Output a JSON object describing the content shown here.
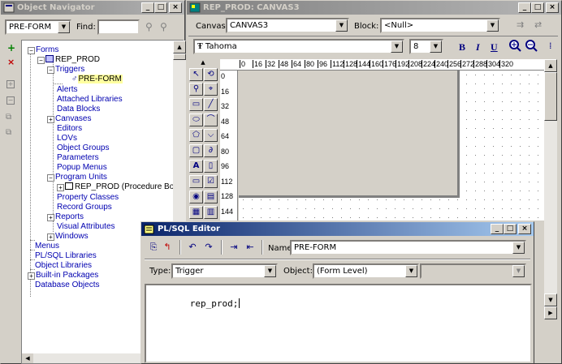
{
  "navigator": {
    "title": "Object Navigator",
    "selector_value": "PRE-FORM",
    "find_label": "Find:",
    "find_value": "",
    "tree": {
      "forms": "Forms",
      "module": "REP_PROD",
      "triggers": "Triggers",
      "trigger_item": "PRE-FORM",
      "alerts": "Alerts",
      "attached_libraries": "Attached Libraries",
      "data_blocks": "Data Blocks",
      "canvases": "Canvases",
      "editors": "Editors",
      "lovs": "LOVs",
      "object_groups": "Object Groups",
      "parameters": "Parameters",
      "popup_menus": "Popup Menus",
      "program_units": "Program Units",
      "program_unit_item": "REP_PROD (Procedure Body",
      "property_classes": "Property Classes",
      "record_groups": "Record Groups",
      "reports": "Reports",
      "visual_attributes": "Visual Attributes",
      "windows": "Windows",
      "menus": "Menus",
      "plsql_libraries": "PL/SQL Libraries",
      "object_libraries": "Object Libraries",
      "builtin_packages": "Built-in Packages",
      "database_objects": "Database Objects"
    }
  },
  "layout_editor": {
    "title": "REP_PROD: CANVAS3",
    "canvas_label": "Canvas:",
    "canvas_value": "CANVAS3",
    "block_label": "Block:",
    "block_value": "<Null>",
    "font_name": "Tahoma",
    "font_size": "8",
    "bold": "B",
    "italic": "I",
    "underline": "U",
    "ruler_top": [
      "0",
      "16",
      "32",
      "48",
      "64",
      "80",
      "96",
      "112",
      "128",
      "144",
      "160",
      "176",
      "192",
      "208",
      "224",
      "240",
      "256",
      "272",
      "288",
      "304",
      "320"
    ],
    "ruler_left": [
      "0",
      "16",
      "32",
      "48",
      "64",
      "80",
      "96",
      "112",
      "128",
      "144"
    ]
  },
  "plsql_editor": {
    "title": "PL/SQL Editor",
    "name_label": "Name:",
    "name_value": "PRE-FORM",
    "type_label": "Type:",
    "type_value": "Trigger",
    "object_label": "Object:",
    "object_value": "(Form Level)",
    "object2_value": "",
    "code": "rep_prod;"
  },
  "colors": {
    "titlebar_active": "#0a246a",
    "titlebar_inactive": "#808080",
    "link_blue": "#0000b0",
    "highlight": "#ffffa0"
  }
}
